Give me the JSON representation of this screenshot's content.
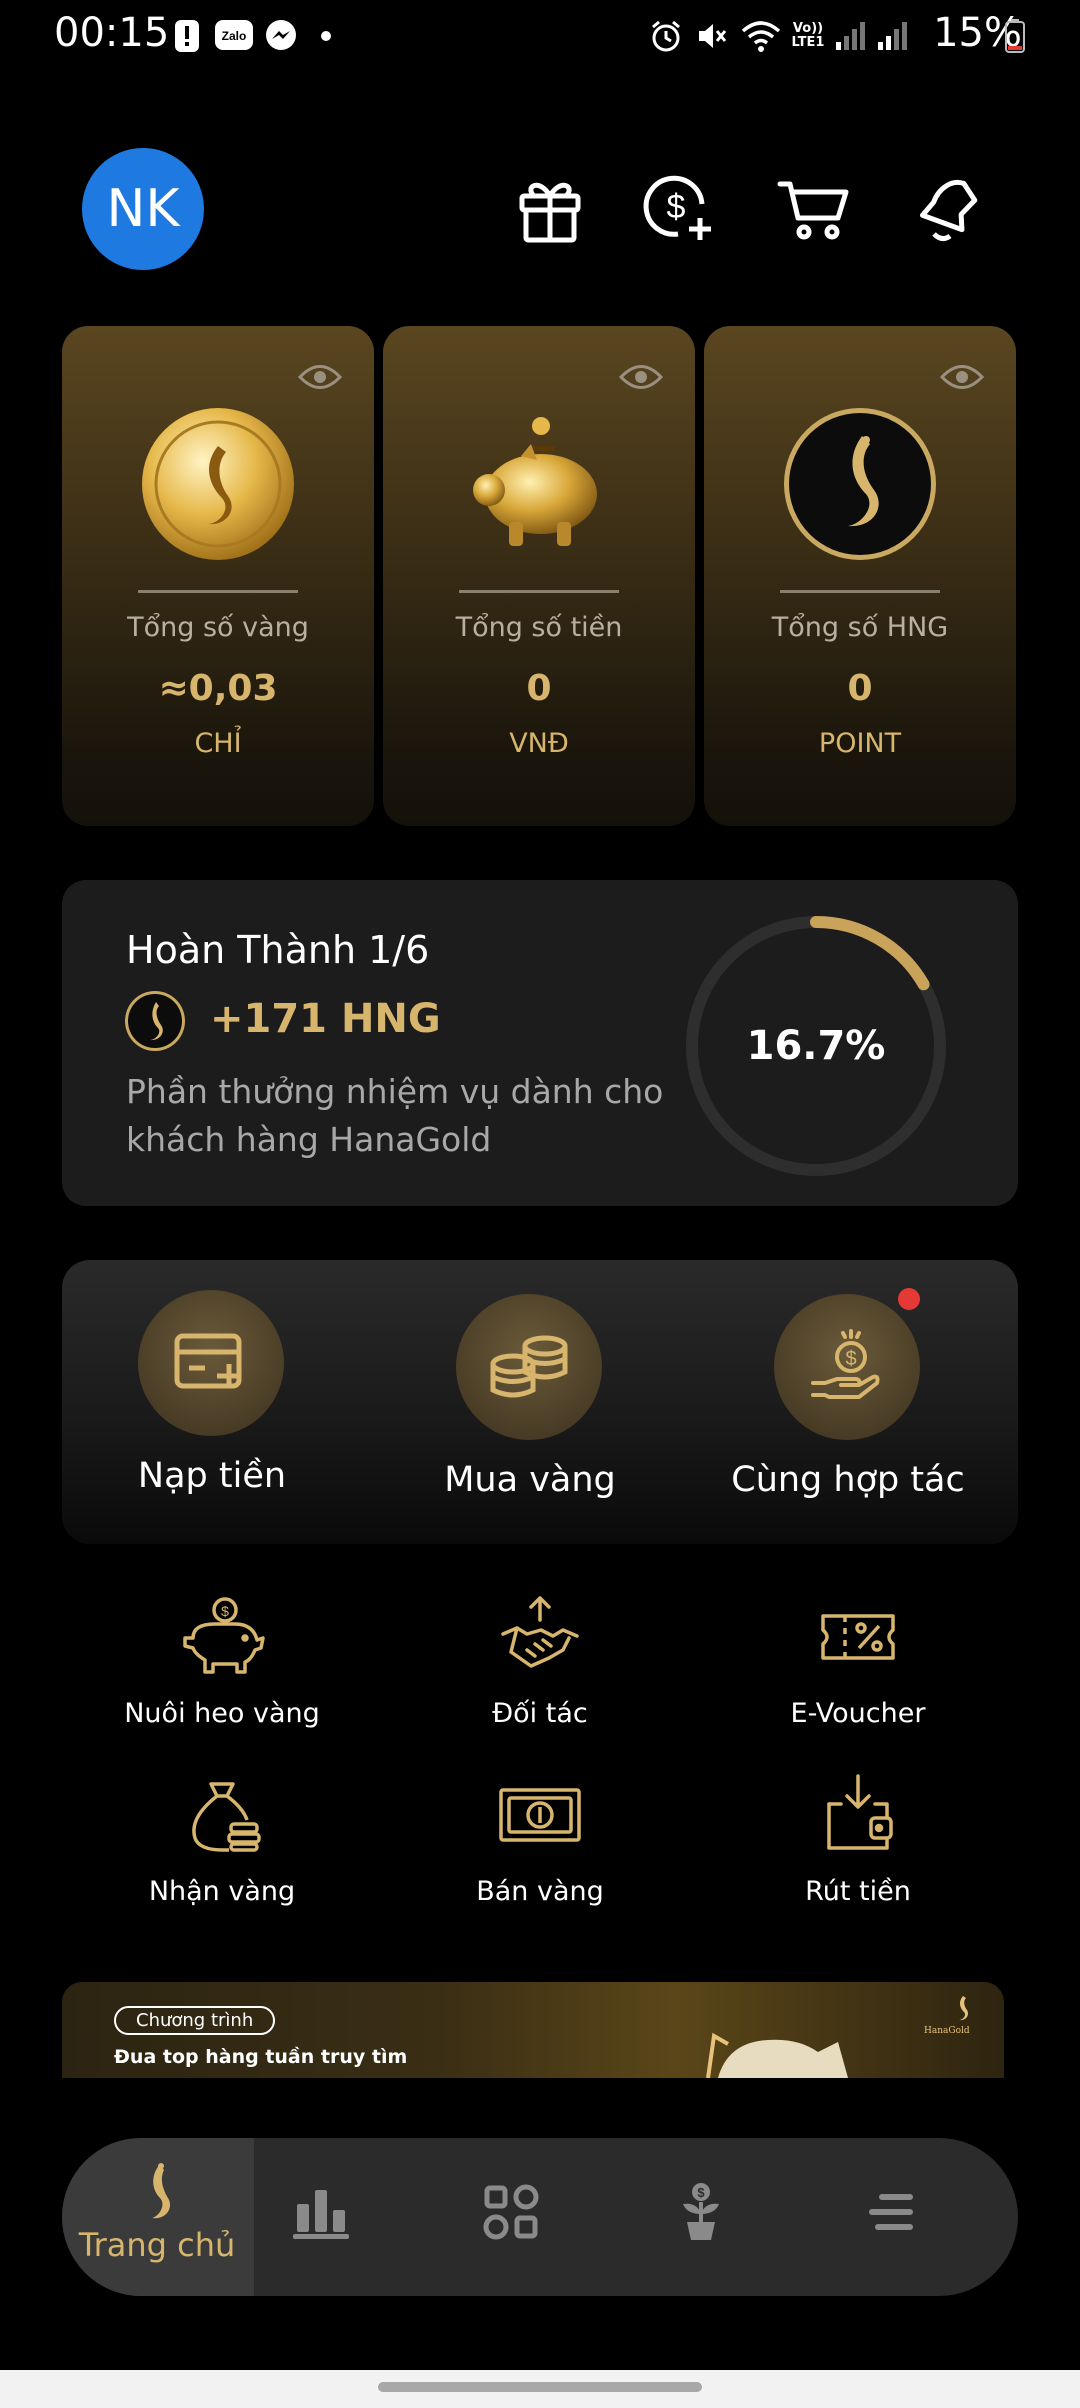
{
  "status_bar": {
    "time": "00:15",
    "battery": "15%",
    "icons": [
      "alert-icon",
      "zalo-icon",
      "messenger-icon",
      "dot-icon",
      "alarm-icon",
      "mute-icon",
      "wifi-icon",
      "volte-icon",
      "signal-icon",
      "signal-icon",
      "battery-icon"
    ],
    "volte_label": "Vo)) LTE1",
    "zalo_label": "Zalo"
  },
  "header": {
    "avatar_initials": "NK",
    "actions": [
      "gift-icon",
      "dollar-plus-icon",
      "cart-icon",
      "bell-icon"
    ]
  },
  "assets": [
    {
      "label": "Tổng số vàng",
      "value": "≈0,03",
      "unit": "CHỈ",
      "art": "gold-coin-icon"
    },
    {
      "label": "Tổng số tiền",
      "value": "0",
      "unit": "VNĐ",
      "art": "piggy-bank-icon"
    },
    {
      "label": "Tổng số HNG",
      "value": "0",
      "unit": "POINT",
      "art": "hng-token-icon"
    }
  ],
  "mission": {
    "title": "Hoàn Thành 1/6",
    "reward": "+171 HNG",
    "description": "Phần thưởng nhiệm vụ dành cho khách hàng HanaGold",
    "progress_label": "16.7%",
    "progress": 0.167
  },
  "quick_actions": [
    {
      "label": "Nạp tiền",
      "icon": "card-plus-icon",
      "badge": false
    },
    {
      "label": "Mua vàng",
      "icon": "coins-stack-icon",
      "badge": false
    },
    {
      "label": "Cùng hợp tác",
      "icon": "hand-coin-icon",
      "badge": true
    }
  ],
  "features": [
    {
      "label": "Nuôi heo vàng",
      "icon": "piggy-icon"
    },
    {
      "label": "Đối tác",
      "icon": "handshake-icon"
    },
    {
      "label": "E-Voucher",
      "icon": "voucher-icon"
    },
    {
      "label": "Nhận vàng",
      "icon": "gold-bag-icon"
    },
    {
      "label": "Bán vàng",
      "icon": "banknote-icon"
    },
    {
      "label": "Rút tiền",
      "icon": "wallet-download-icon"
    }
  ],
  "banner": {
    "pill": "Chương trình",
    "text": "Đua top hàng tuần truy tìm",
    "logo_text": "HanaGold"
  },
  "bottom_nav": {
    "active_label": "Trang chủ",
    "items": [
      "home-icon",
      "chart-icon",
      "apps-grid-icon",
      "plant-coin-icon",
      "menu-icon"
    ]
  },
  "colors": {
    "accent_gold": "#d7b56d",
    "avatar_blue": "#1e7ae0",
    "badge_red": "#e53935",
    "background": "#000000"
  }
}
